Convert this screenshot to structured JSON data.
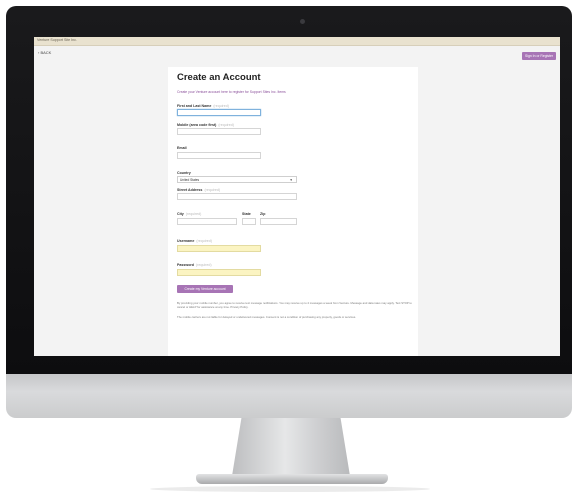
{
  "window": {
    "title": "Venture Support Site Inc."
  },
  "nav": {
    "back_label": "‹ BACK",
    "signin_label": "Sign In or Register"
  },
  "form": {
    "title": "Create an Account",
    "subtitle": "Create your Venture account here to register for Support Sites Inc. Items",
    "required_tag": "(required)",
    "fields": {
      "name_label": "First and Last Name",
      "mobile_label": "Mobile (area code first)",
      "email_label": "Email",
      "country_label": "Country",
      "country_value": "United States",
      "street_label": "Street Address",
      "city_label": "City",
      "state_label": "State",
      "zip_label": "Zip",
      "username_label": "Username",
      "password_label": "Password"
    },
    "submit_label": "Create my Venture account",
    "disclaimer_1": "By providing your mobile number, you agree to receive text message notifications. You may receive up to 4 messages a week from Venture. Message and data rates may apply. Text STOP to cancel or HELP for assistance at any time. Privacy Policy.",
    "disclaimer_2": "The mobile carriers are not liable for delayed or undelivered messages. Consent is not a condition of purchasing any property, goods or services."
  },
  "colors": {
    "accent": "#a774b5",
    "field_highlight": "#fbf4c2",
    "focus": "#7fb2dd"
  }
}
